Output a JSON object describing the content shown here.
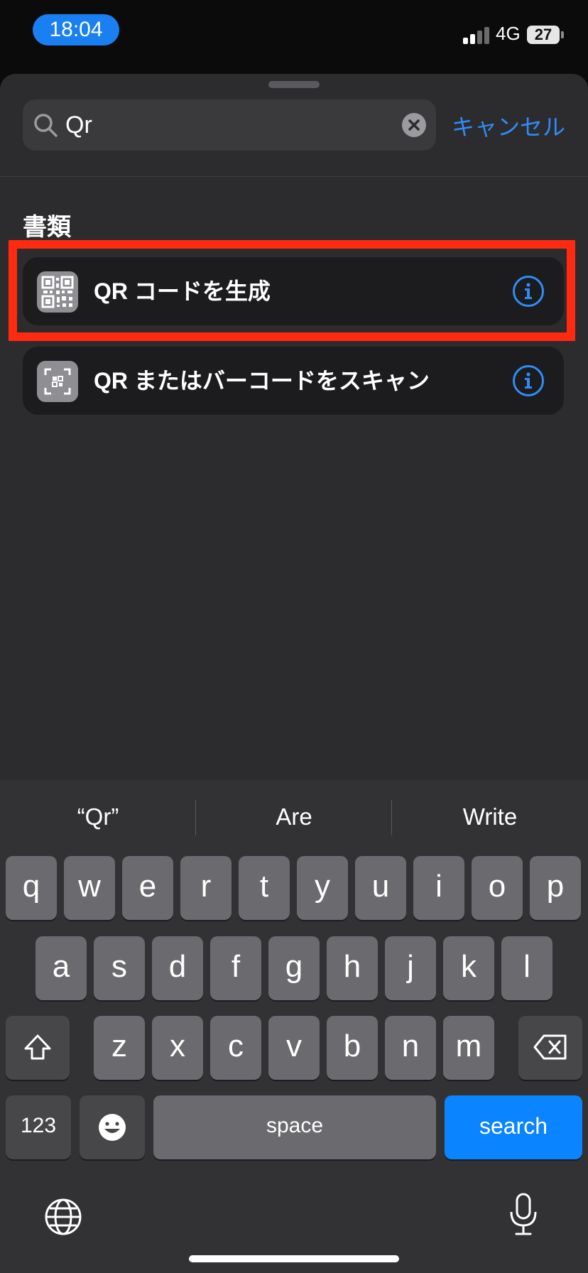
{
  "status_bar": {
    "time": "18:04",
    "network": "4G",
    "battery": "27"
  },
  "search": {
    "query": "Qr",
    "cancel_label": "キャンセル"
  },
  "section": {
    "title": "書類"
  },
  "results": [
    {
      "label": "QR コードを生成"
    },
    {
      "label": "QR またはバーコードをスキャン"
    }
  ],
  "keyboard": {
    "suggestions": [
      "“Qr”",
      "Are",
      "Write"
    ],
    "row1": [
      "q",
      "w",
      "e",
      "r",
      "t",
      "y",
      "u",
      "i",
      "o",
      "p"
    ],
    "row2": [
      "a",
      "s",
      "d",
      "f",
      "g",
      "h",
      "j",
      "k",
      "l"
    ],
    "row3": [
      "z",
      "x",
      "c",
      "v",
      "b",
      "n",
      "m"
    ],
    "numbers_label": "123",
    "space_label": "space",
    "search_label": "search"
  },
  "colors": {
    "accent": "#0a84ff",
    "highlight": "#ff2a10"
  }
}
